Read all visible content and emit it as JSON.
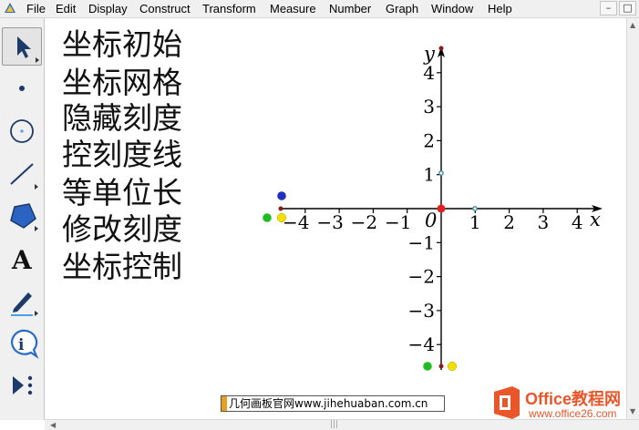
{
  "menubar": {
    "items": [
      "File",
      "Edit",
      "Display",
      "Construct",
      "Transform",
      "Measure",
      "Number",
      "Graph",
      "Window",
      "Help"
    ],
    "window_buttons": [
      "–",
      "□"
    ]
  },
  "toolbar": {
    "tools": [
      {
        "name": "arrow-tool-icon",
        "selected": true
      },
      {
        "name": "point-tool-icon",
        "selected": false
      },
      {
        "name": "compass-tool-icon",
        "selected": false
      },
      {
        "name": "straightedge-tool-icon",
        "selected": false
      },
      {
        "name": "polygon-tool-icon",
        "selected": false
      },
      {
        "name": "text-tool-icon",
        "selected": false
      },
      {
        "name": "marker-tool-icon",
        "selected": false
      },
      {
        "name": "information-tool-icon",
        "selected": false
      },
      {
        "name": "custom-tool-icon",
        "selected": false
      }
    ]
  },
  "canvas": {
    "commands": [
      "坐标初始",
      "坐标网格",
      "隐藏刻度",
      "控刻度线",
      "等单位长",
      "修改刻度",
      "坐标控制"
    ]
  },
  "axes": {
    "x_label": "x",
    "y_label": "y",
    "origin_label": "0",
    "x_ticks": [
      "−4",
      "−3",
      "−2",
      "−1",
      "1",
      "2",
      "3",
      "4"
    ],
    "y_ticks": [
      "4",
      "3",
      "2",
      "1",
      "−1",
      "−2",
      "−3",
      "−4"
    ],
    "colors": {
      "axis": "#000000",
      "origin_point": "#e02020",
      "unit_point": "#2e8b9a",
      "blue_point": "#1f2fbf",
      "green_point": "#22bb22",
      "yellow_point": "#f2e000",
      "dark_red_point": "#8b1a1a"
    }
  },
  "watermark": {
    "site_text": "几何画板官网www.jihehuaban.com.cn",
    "logo_text": "Office教程网",
    "logo_url": "www.office26.com",
    "logo_color": "#e8562a"
  }
}
